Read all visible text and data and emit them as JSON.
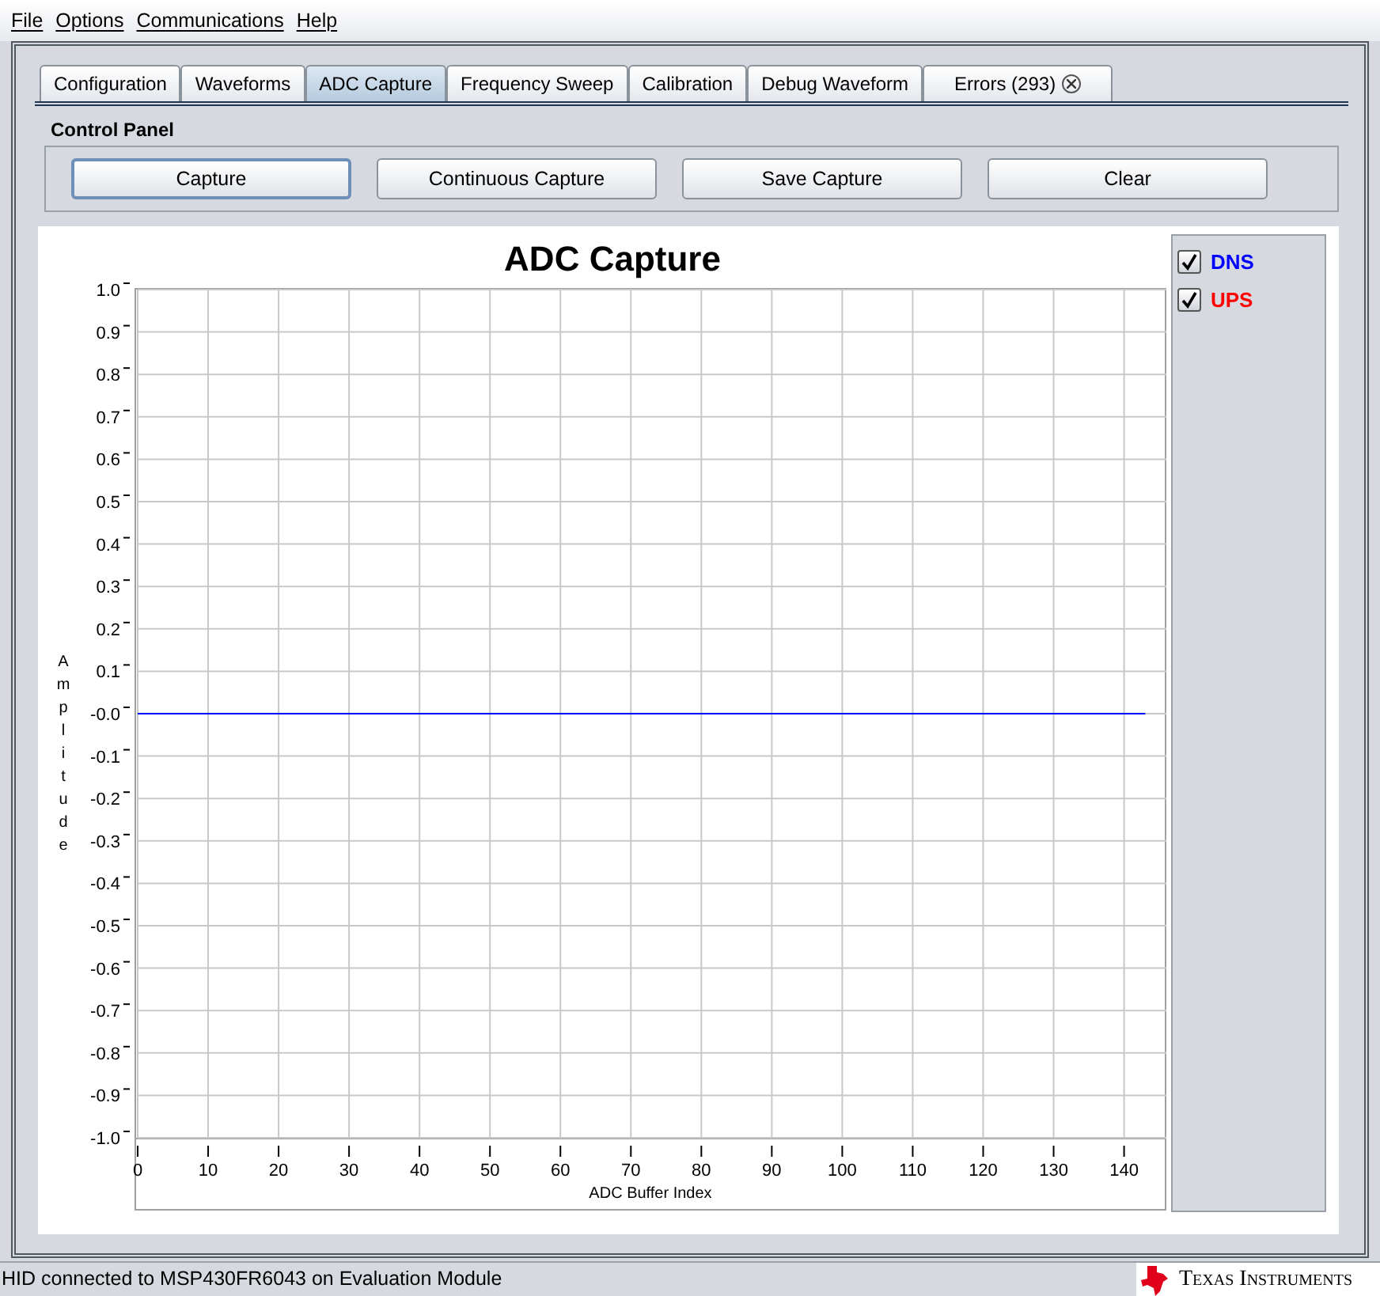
{
  "menu": [
    {
      "label": "File"
    },
    {
      "label": "Options"
    },
    {
      "label": "Communications"
    },
    {
      "label": "Help"
    }
  ],
  "tabs": [
    {
      "label": "Configuration",
      "selected": false,
      "closable": false
    },
    {
      "label": "Waveforms",
      "selected": false,
      "closable": false
    },
    {
      "label": "ADC Capture",
      "selected": true,
      "closable": false
    },
    {
      "label": "Frequency Sweep",
      "selected": false,
      "closable": false
    },
    {
      "label": "Calibration",
      "selected": false,
      "closable": false
    },
    {
      "label": "Debug Waveform",
      "selected": false,
      "closable": false
    },
    {
      "label": "Errors (293)",
      "selected": false,
      "closable": true
    }
  ],
  "control_panel": {
    "title": "Control Panel",
    "buttons": [
      {
        "label": "Capture",
        "focused": true
      },
      {
        "label": "Continuous Capture",
        "focused": false
      },
      {
        "label": "Save Capture",
        "focused": false
      },
      {
        "label": "Clear",
        "focused": false
      }
    ]
  },
  "chart": {
    "chart_data": {
      "type": "line",
      "title": "ADC Capture",
      "xlabel": "ADC Buffer Index",
      "ylabel": "Amplitude",
      "x": [
        0,
        143
      ],
      "series": [
        {
          "name": "DNS",
          "color": "#0000ff",
          "values": [
            0,
            0
          ]
        }
      ],
      "grid": true,
      "xlim": [
        0,
        146
      ],
      "ylim": [
        -1,
        1
      ],
      "xticks": [
        0,
        10,
        20,
        30,
        40,
        50,
        60,
        70,
        80,
        90,
        100,
        110,
        120,
        130,
        140
      ],
      "yticks": [
        {
          "value": 1,
          "label": "1.0"
        },
        {
          "value": 0.9,
          "label": "0.9"
        },
        {
          "value": 0.8,
          "label": "0.8"
        },
        {
          "value": 0.7,
          "label": "0.7"
        },
        {
          "value": 0.6,
          "label": "0.6"
        },
        {
          "value": 0.5,
          "label": "0.5"
        },
        {
          "value": 0.4,
          "label": "0.4"
        },
        {
          "value": 0.3,
          "label": "0.3"
        },
        {
          "value": 0.2,
          "label": "0.2"
        },
        {
          "value": 0.1,
          "label": "0.1"
        },
        {
          "value": 0,
          "label": "-0.0"
        },
        {
          "value": -0.1,
          "label": "-0.1"
        },
        {
          "value": -0.2,
          "label": "-0.2"
        },
        {
          "value": -0.3,
          "label": "-0.3"
        },
        {
          "value": -0.4,
          "label": "-0.4"
        },
        {
          "value": -0.5,
          "label": "-0.5"
        },
        {
          "value": -0.6,
          "label": "-0.6"
        },
        {
          "value": -0.7,
          "label": "-0.7"
        },
        {
          "value": -0.8,
          "label": "-0.8"
        },
        {
          "value": -0.9,
          "label": "-0.9"
        },
        {
          "value": -1,
          "label": "-1.0"
        }
      ]
    },
    "legend": [
      {
        "checked": true
      },
      {
        "label": "UPS",
        "color": "#ff0000",
        "checked": true
      }
    ]
  },
  "status_bar": {
    "text": "HID connected to MSP430FR6043 on Evaluation Module",
    "logo_text": "Texas Instruments"
  }
}
